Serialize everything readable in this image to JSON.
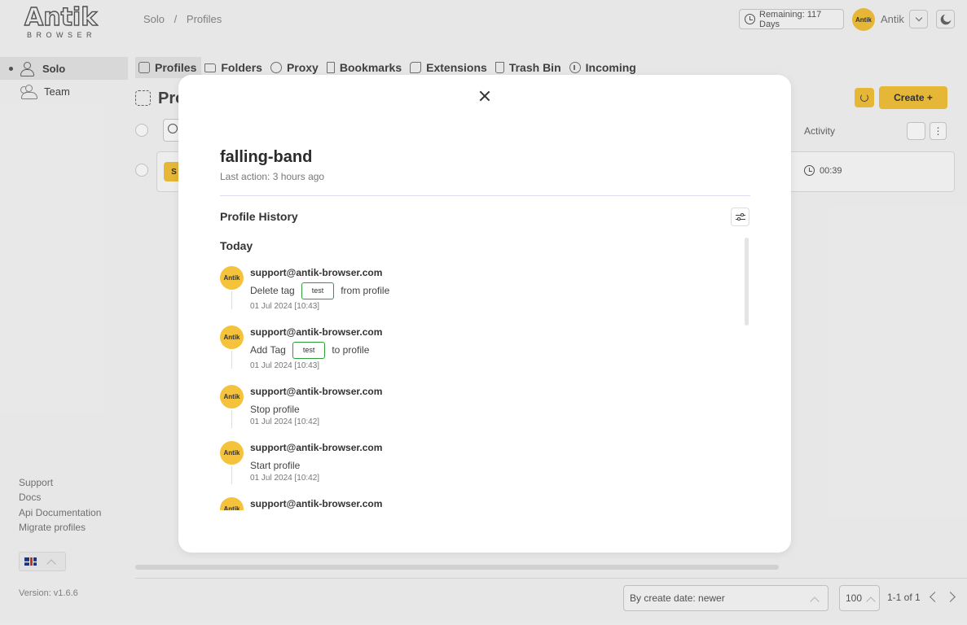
{
  "logo": {
    "main": "Antik",
    "sub": "BROWSER"
  },
  "breadcrumb": [
    "Solo",
    "/",
    "Profiles"
  ],
  "header": {
    "remaining": "Remaining: 117 Days",
    "avatar_text": "Antik",
    "user_name": "Antik"
  },
  "sidebar": {
    "items": [
      {
        "label": "Solo"
      },
      {
        "label": "Team"
      }
    ],
    "links": [
      "Support",
      "Docs",
      "Api Documentation",
      "Migrate profiles"
    ],
    "version": "Version: v1.6.6"
  },
  "tabs": [
    {
      "label": "Profiles"
    },
    {
      "label": "Folders"
    },
    {
      "label": "Proxy"
    },
    {
      "label": "Bookmarks"
    },
    {
      "label": "Extensions"
    },
    {
      "label": "Trash Bin"
    },
    {
      "label": "Incoming"
    }
  ],
  "main": {
    "title_partial": "Pro",
    "create_label": "Create +",
    "activity_header": "Activity",
    "row_time": "00:39",
    "row_tag": "S"
  },
  "footer": {
    "sort_value": "By create date: newer",
    "per_page": "100",
    "pagination": "1-1 of 1"
  },
  "modal": {
    "title": "falling-band",
    "subtitle": "Last action: 3 hours ago",
    "history_title": "Profile History",
    "group_label": "Today",
    "entries": [
      {
        "avatar": "Antik",
        "email": "support@antik-browser.com",
        "before": "Delete tag",
        "tag": "test",
        "after": "from profile",
        "date": "01 Jul 2024 [10:43]"
      },
      {
        "avatar": "Antik",
        "email": "support@antik-browser.com",
        "before": "Add Tag",
        "tag": "test",
        "after": "to profile",
        "date": "01 Jul 2024 [10:43]"
      },
      {
        "avatar": "Antik",
        "email": "support@antik-browser.com",
        "before": "Stop profile",
        "date": "01 Jul 2024 [10:42]"
      },
      {
        "avatar": "Antik",
        "email": "support@antik-browser.com",
        "before": "Start profile",
        "date": "01 Jul 2024 [10:42]"
      },
      {
        "avatar": "Antik",
        "email": "support@antik-browser.com"
      }
    ]
  }
}
